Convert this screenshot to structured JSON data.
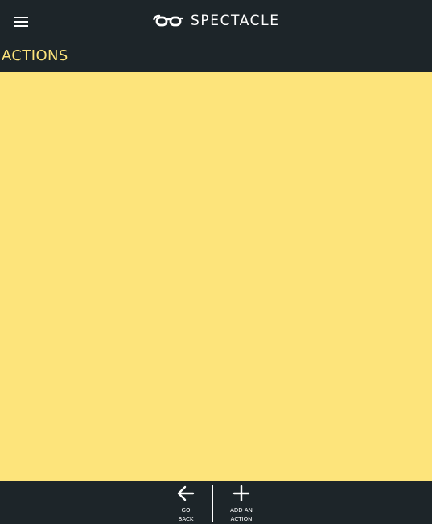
{
  "app": {
    "name": "SPECTACLE",
    "logo_icon": "glasses-logo-icon",
    "menu_icon": "hamburger-menu-icon"
  },
  "section": {
    "title": "ACTIONS"
  },
  "bottom_bar": {
    "back": {
      "icon": "arrow-left-icon",
      "label": "GO\nBACK"
    },
    "add": {
      "icon": "plus-icon",
      "label": "ADD AN\nACTION"
    }
  },
  "colors": {
    "dark_bg": "#1d2529",
    "accent_yellow": "#fde47b",
    "text_light": "#ffffff"
  }
}
